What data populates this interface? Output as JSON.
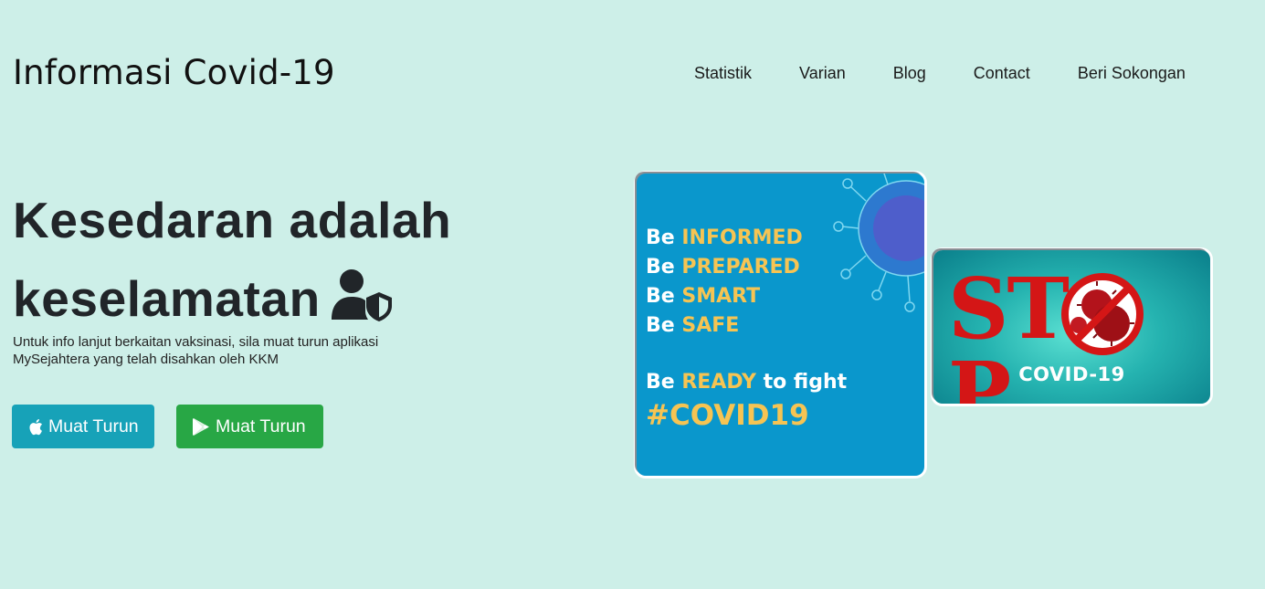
{
  "header": {
    "brand": "Informasi Covid-19",
    "nav": [
      "Statistik",
      "Varian",
      "Blog",
      "Contact",
      "Beri Sokongan"
    ]
  },
  "hero": {
    "title_line1": "Kesedaran adalah",
    "title_line2": "keselamatan",
    "title_icon": "user-shield-icon",
    "subtitle": "Untuk info lanjut berkaitan vaksinasi, sila muat turun aplikasi MySejahtera yang telah disahkan oleh KKM",
    "buttons": [
      {
        "label": "Muat Turun",
        "icon": "apple-icon",
        "color": "#17a2b8"
      },
      {
        "label": "Muat Turun",
        "icon": "google-play-icon",
        "color": "#28a745"
      }
    ]
  },
  "poster_blue": {
    "lines": [
      {
        "pre": "Be ",
        "hl": "INFORMED"
      },
      {
        "pre": "Be ",
        "hl": "PREPARED"
      },
      {
        "pre": "Be ",
        "hl": "SMART"
      },
      {
        "pre": "Be ",
        "hl": "SAFE"
      }
    ],
    "ready_pre": "Be ",
    "ready_hl": "READY",
    "ready_post": " to fight",
    "hashtag": "#COVID19"
  },
  "poster_stop": {
    "word_left": "ST",
    "word_right": "P",
    "caption": "COVID-19"
  },
  "colors": {
    "background": "#cdefe8",
    "accent_yellow": "#f6c453",
    "stop_red": "#d41616"
  }
}
